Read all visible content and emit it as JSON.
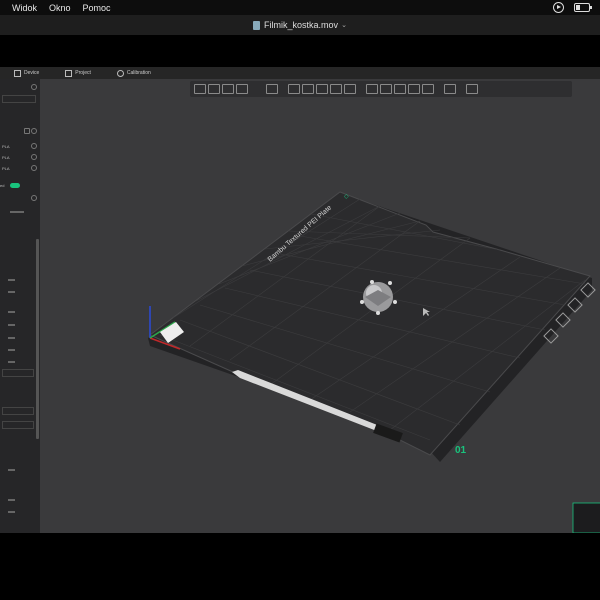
{
  "menubar": {
    "items": [
      {
        "label": "Widok"
      },
      {
        "label": "Okno"
      },
      {
        "label": "Pomoc"
      }
    ]
  },
  "window": {
    "title": "Filmik_kostka.mov"
  },
  "app_tabs": [
    {
      "label": "Device"
    },
    {
      "label": "Project"
    },
    {
      "label": "Calibration"
    }
  ],
  "sidebar": {
    "filaments": [
      {
        "label": "PLA"
      },
      {
        "label": "PLA"
      },
      {
        "label": "PLA"
      }
    ],
    "toggle_label": "ed"
  },
  "plate": {
    "brand": "Bambu Textured PEI Plate",
    "plate_number": "01"
  },
  "colors": {
    "accent": "#19c37d",
    "bed": "#2b2b2d",
    "viewport": "#3a3a3c"
  }
}
